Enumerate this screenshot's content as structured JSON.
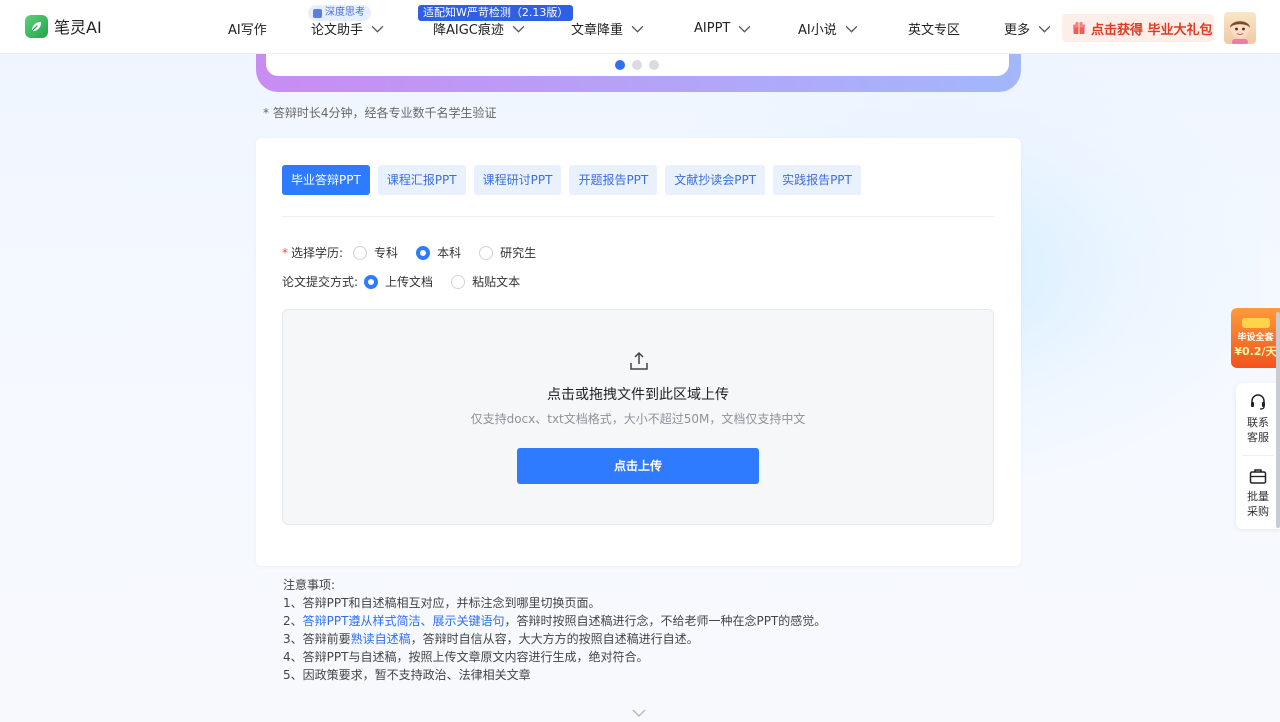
{
  "app": {
    "name": "笔灵AI"
  },
  "nav": {
    "items": [
      {
        "label": "AI写作",
        "has_menu": false
      },
      {
        "label": "论文助手",
        "has_menu": true,
        "badge": "深度思考"
      },
      {
        "label": "降AIGC痕迹",
        "has_menu": true,
        "badge": "适配知W严苛检测（2.13版）"
      },
      {
        "label": "文章降重",
        "has_menu": true
      },
      {
        "label": "AIPPT",
        "has_menu": true
      },
      {
        "label": "AI小说",
        "has_menu": true
      },
      {
        "label": "英文专区",
        "has_menu": false
      },
      {
        "label": "更多",
        "has_menu": true
      }
    ],
    "gift_button": "点击获得 毕业大礼包"
  },
  "carousel": {
    "dot_count": 3,
    "active_index": 0
  },
  "top_note": "* 答辩时长4分钟，经各专业数千名学生验证",
  "tabs": [
    {
      "label": "毕业答辩PPT",
      "active": true
    },
    {
      "label": "课程汇报PPT",
      "active": false
    },
    {
      "label": "课程研讨PPT",
      "active": false
    },
    {
      "label": "开题报告PPT",
      "active": false
    },
    {
      "label": "文献抄读会PPT",
      "active": false
    },
    {
      "label": "实践报告PPT",
      "active": false
    }
  ],
  "form": {
    "education": {
      "label": "选择学历:",
      "options": [
        "专科",
        "本科",
        "研究生"
      ],
      "selected": "本科"
    },
    "submit_method": {
      "label": "论文提交方式:",
      "options": [
        "上传文档",
        "粘贴文本"
      ],
      "selected": "上传文档"
    }
  },
  "upload": {
    "title": "点击或拖拽文件到此区域上传",
    "hint": "仅支持docx、txt文档格式，大小不超过50M，文档仅支持中文",
    "button": "点击上传"
  },
  "notes": {
    "heading": "注意事项:",
    "item1": "1、答辩PPT和自述稿相互对应，并标注念到哪里切换页面。",
    "item2_prefix": "2、",
    "item2_highlight": "答辩PPT遵从样式简洁、展示关键语句",
    "item2_suffix": "，答辩时按照自述稿进行念，不给老师一种在念PPT的感觉。",
    "item3_prefix": "3、答辩前要",
    "item3_highlight": "熟读自述稿",
    "item3_suffix": "，答辩时自信从容，大大方方的按照自述稿进行自述。",
    "item4": "4、答辩PPT与自述稿，按照上传文章原文内容进行生成，绝对符合。",
    "item5": "5、因政策要求，暂不支持政治、法律相关文章"
  },
  "side": {
    "promo_line1": "毕设全套",
    "promo_line2": "¥0.2/天",
    "service_line1": "联系",
    "service_line2": "客服",
    "bulk_line1": "批量",
    "bulk_line2": "采购"
  },
  "colors": {
    "primary": "#2f7bff",
    "accent_red": "#e03a20",
    "highlight": "#2f6ff5"
  }
}
